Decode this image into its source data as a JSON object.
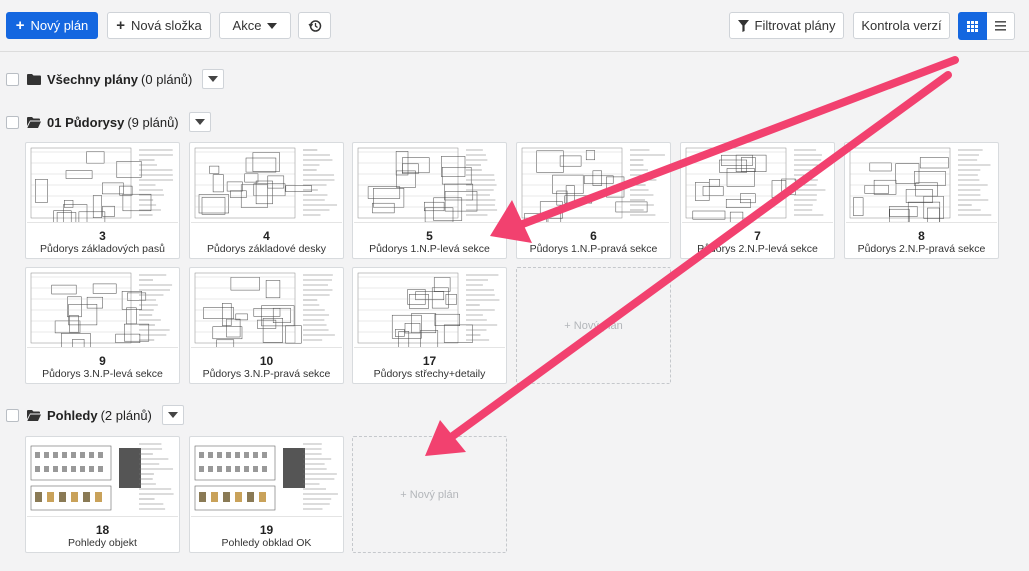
{
  "toolbar": {
    "new_plan": "Nový plán",
    "new_folder": "Nová složka",
    "actions": "Akce",
    "filter_plans": "Filtrovat plány",
    "version_control": "Kontrola verzí"
  },
  "groups": [
    {
      "name": "Všechny plány",
      "count": "(0 plánů)"
    },
    {
      "name": "01 Půdorysy",
      "count": "(9 plánů)"
    },
    {
      "name": "Pohledy",
      "count": "(2 plánů)"
    }
  ],
  "plans_pudorysy": [
    {
      "num": "3",
      "title": "Půdorys základových pasů"
    },
    {
      "num": "4",
      "title": "Půdorys základové desky"
    },
    {
      "num": "5",
      "title": "Půdorys 1.N.P-levá sekce"
    },
    {
      "num": "6",
      "title": "Půdorys 1.N.P-pravá sekce"
    },
    {
      "num": "7",
      "title": "Půdorys 2.N.P-levá sekce"
    },
    {
      "num": "8",
      "title": "Půdorys 2.N.P-pravá sekce"
    },
    {
      "num": "9",
      "title": "Půdorys 3.N.P-levá sekce"
    },
    {
      "num": "10",
      "title": "Půdorys 3.N.P-pravá sekce"
    },
    {
      "num": "17",
      "title": "Půdorys střechy+detaily"
    }
  ],
  "plans_pohledy": [
    {
      "num": "18",
      "title": "Pohledy objekt"
    },
    {
      "num": "19",
      "title": "Pohledy obklad OK"
    }
  ],
  "new_plan_card": "+ Nový plán",
  "colors": {
    "accent": "#1467e0",
    "annotation_arrow": "#f2416f"
  },
  "icons": [
    "plus-icon",
    "caret-down-icon",
    "history-icon",
    "filter-icon",
    "grid-view-icon",
    "list-view-icon",
    "folder-icon",
    "folder-open-icon"
  ]
}
